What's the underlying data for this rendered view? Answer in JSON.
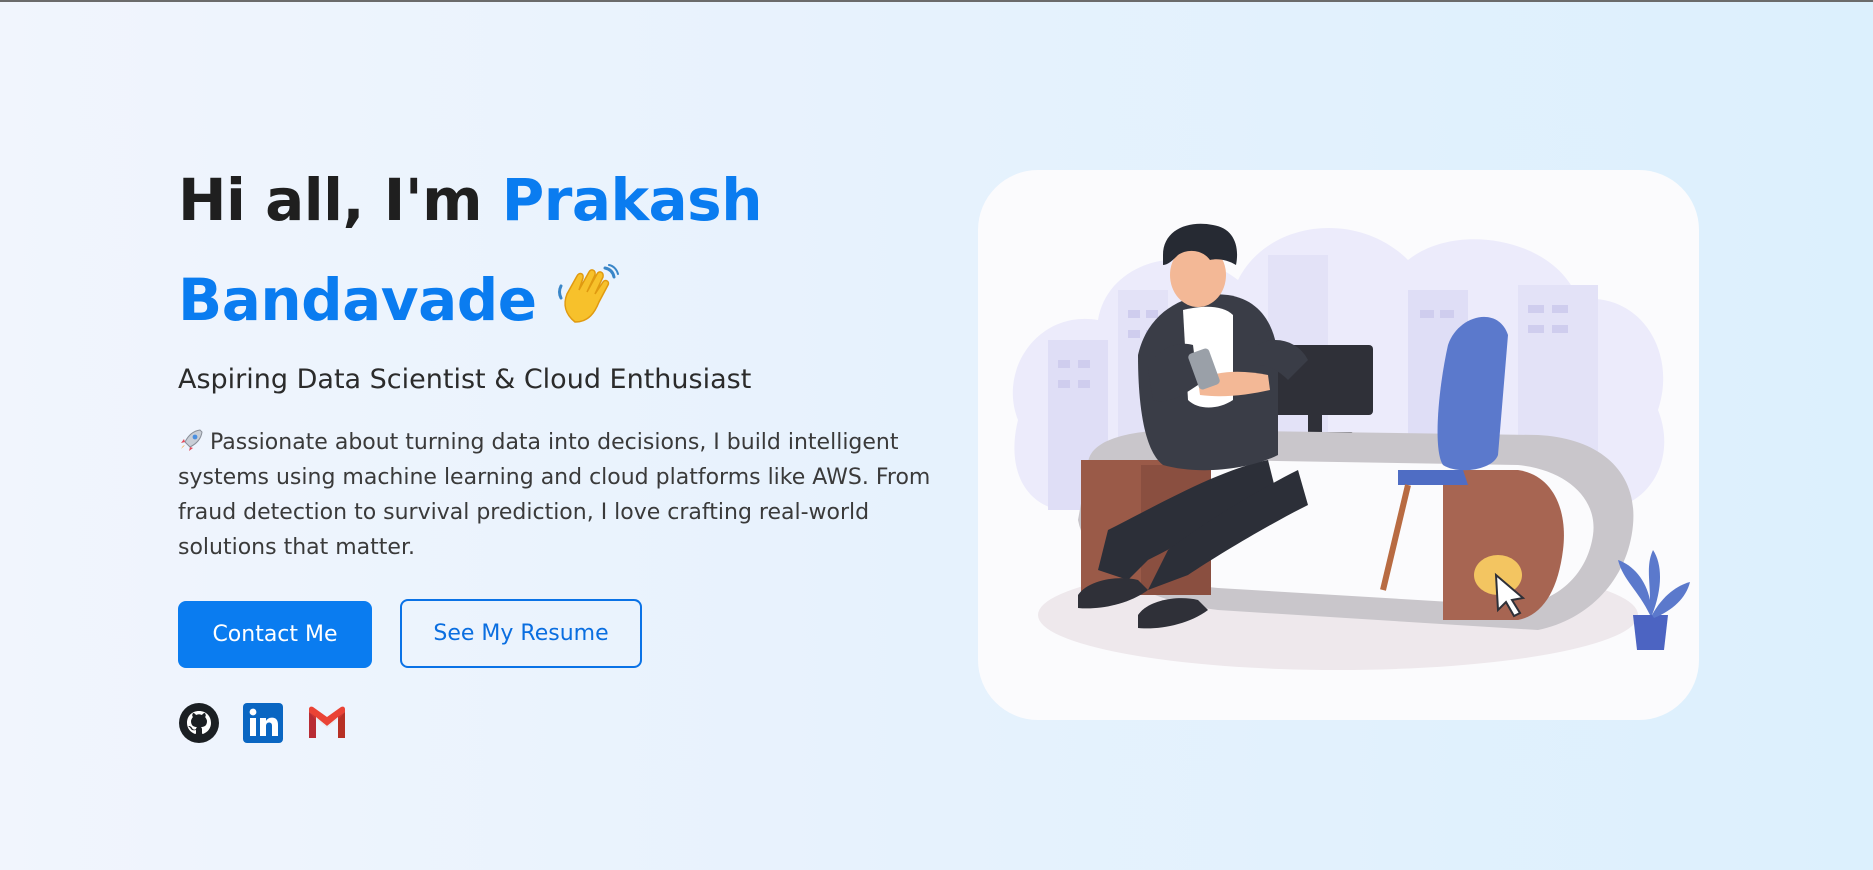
{
  "hero": {
    "greeting": "Hi all, I'm ",
    "name_first": "Prakash",
    "name_last": "Bandavade",
    "subtitle": "Aspiring Data Scientist & Cloud Enthusiast",
    "description": "Passionate about turning data into decisions, I build intelligent systems using machine learning and cloud platforms like AWS. From fraud detection to survival prediction, I love crafting real-world solutions that matter."
  },
  "buttons": {
    "contact_label": "Contact Me",
    "resume_label": "See My Resume"
  },
  "socials": [
    {
      "name": "github-icon"
    },
    {
      "name": "linkedin-icon"
    },
    {
      "name": "gmail-icon"
    }
  ],
  "icons": {
    "wave": "waving-hand-icon",
    "rocket": "rocket-icon",
    "illustration": "person-at-desk-illustration"
  },
  "colors": {
    "accent": "#0a7cf0",
    "heading": "#1f1f1f",
    "button_bg": "#0a7cf0"
  }
}
